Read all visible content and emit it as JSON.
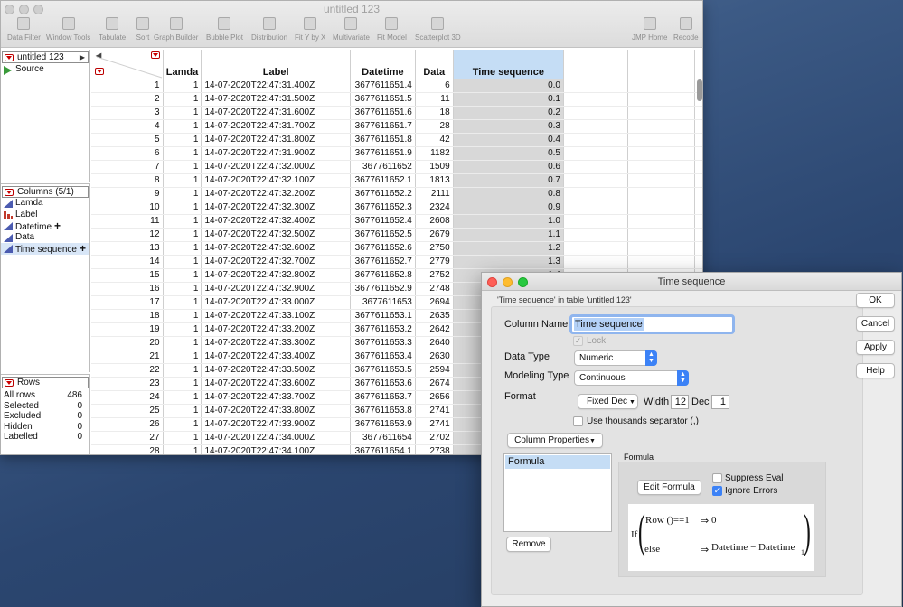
{
  "main_window": {
    "title": "untitled 123",
    "toolbar": [
      {
        "label": "Data Filter",
        "icon": "data-filter-icon"
      },
      {
        "label": "Window Tools",
        "icon": "window-tools-icon"
      },
      {
        "label": "Tabulate",
        "icon": "tabulate-icon"
      },
      {
        "label": "Sort",
        "icon": "sort-icon"
      },
      {
        "label": "Graph Builder",
        "icon": "graph-builder-icon"
      },
      {
        "label": "Bubble Plot",
        "icon": "bubble-plot-icon"
      },
      {
        "label": "Distribution",
        "icon": "distribution-icon"
      },
      {
        "label": "Fit Y by X",
        "icon": "fit-y-by-x-icon"
      },
      {
        "label": "Multivariate",
        "icon": "multivariate-icon"
      },
      {
        "label": "Fit Model",
        "icon": "fit-model-icon"
      },
      {
        "label": "Scatterplot 3D",
        "icon": "scatterplot-3d-icon"
      },
      {
        "label": "JMP Home",
        "icon": "home-icon"
      },
      {
        "label": "Recode",
        "icon": "recode-icon"
      }
    ]
  },
  "table_panel": {
    "name": "untitled 123",
    "items": [
      "Source"
    ]
  },
  "columns_panel": {
    "header": "Columns (5/1)",
    "items": [
      {
        "label": "Lamda",
        "icon": "continuous-icon",
        "marker": ""
      },
      {
        "label": "Label",
        "icon": "nominal-icon",
        "marker": ""
      },
      {
        "label": "Datetime",
        "icon": "continuous-icon",
        "marker": "+"
      },
      {
        "label": "Data",
        "icon": "continuous-icon",
        "marker": ""
      },
      {
        "label": "Time sequence",
        "icon": "continuous-icon",
        "marker": "+"
      }
    ]
  },
  "rows_panel": {
    "header": "Rows",
    "stats": [
      {
        "label": "All rows",
        "value": "486"
      },
      {
        "label": "Selected",
        "value": "0"
      },
      {
        "label": "Excluded",
        "value": "0"
      },
      {
        "label": "Hidden",
        "value": "0"
      },
      {
        "label": "Labelled",
        "value": "0"
      }
    ]
  },
  "grid": {
    "headers": [
      "Lamda",
      "Label",
      "Datetime",
      "Data",
      "Time sequence"
    ],
    "rows": [
      [
        "1",
        "1",
        "14-07-2020T22:47:31.400Z",
        "3677611651.4",
        "6",
        "0.0"
      ],
      [
        "2",
        "1",
        "14-07-2020T22:47:31.500Z",
        "3677611651.5",
        "11",
        "0.1"
      ],
      [
        "3",
        "1",
        "14-07-2020T22:47:31.600Z",
        "3677611651.6",
        "18",
        "0.2"
      ],
      [
        "4",
        "1",
        "14-07-2020T22:47:31.700Z",
        "3677611651.7",
        "28",
        "0.3"
      ],
      [
        "5",
        "1",
        "14-07-2020T22:47:31.800Z",
        "3677611651.8",
        "42",
        "0.4"
      ],
      [
        "6",
        "1",
        "14-07-2020T22:47:31.900Z",
        "3677611651.9",
        "1182",
        "0.5"
      ],
      [
        "7",
        "1",
        "14-07-2020T22:47:32.000Z",
        "3677611652",
        "1509",
        "0.6"
      ],
      [
        "8",
        "1",
        "14-07-2020T22:47:32.100Z",
        "3677611652.1",
        "1813",
        "0.7"
      ],
      [
        "9",
        "1",
        "14-07-2020T22:47:32.200Z",
        "3677611652.2",
        "2111",
        "0.8"
      ],
      [
        "10",
        "1",
        "14-07-2020T22:47:32.300Z",
        "3677611652.3",
        "2324",
        "0.9"
      ],
      [
        "11",
        "1",
        "14-07-2020T22:47:32.400Z",
        "3677611652.4",
        "2608",
        "1.0"
      ],
      [
        "12",
        "1",
        "14-07-2020T22:47:32.500Z",
        "3677611652.5",
        "2679",
        "1.1"
      ],
      [
        "13",
        "1",
        "14-07-2020T22:47:32.600Z",
        "3677611652.6",
        "2750",
        "1.2"
      ],
      [
        "14",
        "1",
        "14-07-2020T22:47:32.700Z",
        "3677611652.7",
        "2779",
        "1.3"
      ],
      [
        "15",
        "1",
        "14-07-2020T22:47:32.800Z",
        "3677611652.8",
        "2752",
        "1.4"
      ],
      [
        "16",
        "1",
        "14-07-2020T22:47:32.900Z",
        "3677611652.9",
        "2748",
        ""
      ],
      [
        "17",
        "1",
        "14-07-2020T22:47:33.000Z",
        "3677611653",
        "2694",
        ""
      ],
      [
        "18",
        "1",
        "14-07-2020T22:47:33.100Z",
        "3677611653.1",
        "2635",
        ""
      ],
      [
        "19",
        "1",
        "14-07-2020T22:47:33.200Z",
        "3677611653.2",
        "2642",
        ""
      ],
      [
        "20",
        "1",
        "14-07-2020T22:47:33.300Z",
        "3677611653.3",
        "2640",
        ""
      ],
      [
        "21",
        "1",
        "14-07-2020T22:47:33.400Z",
        "3677611653.4",
        "2630",
        ""
      ],
      [
        "22",
        "1",
        "14-07-2020T22:47:33.500Z",
        "3677611653.5",
        "2594",
        ""
      ],
      [
        "23",
        "1",
        "14-07-2020T22:47:33.600Z",
        "3677611653.6",
        "2674",
        ""
      ],
      [
        "24",
        "1",
        "14-07-2020T22:47:33.700Z",
        "3677611653.7",
        "2656",
        ""
      ],
      [
        "25",
        "1",
        "14-07-2020T22:47:33.800Z",
        "3677611653.8",
        "2741",
        ""
      ],
      [
        "26",
        "1",
        "14-07-2020T22:47:33.900Z",
        "3677611653.9",
        "2741",
        ""
      ],
      [
        "27",
        "1",
        "14-07-2020T22:47:34.000Z",
        "3677611654",
        "2702",
        ""
      ],
      [
        "28",
        "1",
        "14-07-2020T22:47:34.100Z",
        "3677611654.1",
        "2738",
        ""
      ],
      [
        "29",
        "1",
        "14-07-2020T22:47:34.200Z",
        "3677611654.2",
        "2653",
        ""
      ]
    ]
  },
  "dialog": {
    "title": "Time sequence",
    "subtitle": "'Time sequence' in table 'untitled 123'",
    "column_name_label": "Column Name",
    "column_name_value": "Time sequence",
    "lock_label": "Lock",
    "data_type_label": "Data Type",
    "data_type_value": "Numeric",
    "modeling_type_label": "Modeling Type",
    "modeling_type_value": "Continuous",
    "format_label": "Format",
    "format_value": "Fixed Dec",
    "width_label": "Width",
    "width_value": "12",
    "dec_label": "Dec",
    "dec_value": "1",
    "thousands_label": "Use thousands separator (,)",
    "column_properties_label": "Column Properties",
    "properties_list": [
      "Formula"
    ],
    "remove_label": "Remove",
    "formula_group_label": "Formula",
    "edit_formula_label": "Edit Formula",
    "suppress_eval_label": "Suppress Eval",
    "ignore_errors_label": "Ignore Errors",
    "formula": {
      "if_kw": "If",
      "row_expr": "Row ()==1",
      "then_arrow": "⇒",
      "then_value": "0",
      "else_kw": "else",
      "else_arrow": "⇒",
      "else_expr": "Datetime − Datetime",
      "else_sub": "1"
    },
    "buttons": {
      "ok": "OK",
      "cancel": "Cancel",
      "apply": "Apply",
      "help": "Help"
    }
  },
  "colors": {
    "accent": "#3c82f6",
    "selected_header": "#c5ddf5",
    "selected_column": "#d8d8d8",
    "hotspot_red": "#cc0000",
    "desktop": "#2b4670"
  }
}
